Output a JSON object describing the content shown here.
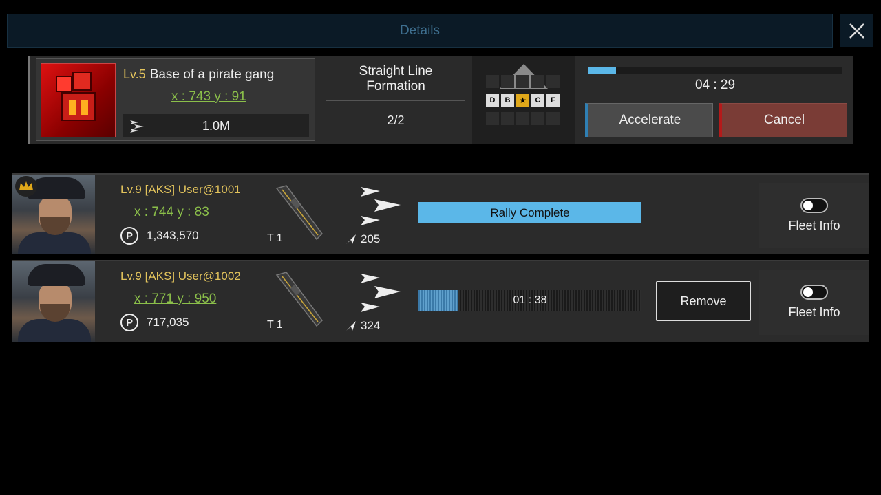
{
  "header": {
    "title": "Details"
  },
  "target": {
    "level": "Lv.5",
    "name": "Base of a pirate gang",
    "coord": "x : 743  y : 91",
    "power": "1.0M",
    "formation_name_line1": "Straight Line",
    "formation_name_line2": "Formation",
    "formation_count": "2/2",
    "grid_labels": [
      "D",
      "B",
      "★",
      "C",
      "F"
    ],
    "progress": 0.11,
    "timer": "04 : 29",
    "accelerate_label": "Accelerate",
    "cancel_label": "Cancel"
  },
  "members": [
    {
      "leader": true,
      "name": "Lv.9 [AKS] User@1001",
      "coord": "x : 744  y : 83",
      "power": "1,343,570",
      "tier": "T 1",
      "troops": "205",
      "status": "Rally Complete",
      "fleet_info_label": "Fleet Info"
    },
    {
      "leader": false,
      "name": "Lv.9 [AKS] User@1002",
      "coord": "x : 771  y : 950",
      "power": "717,035",
      "tier": "T 1",
      "troops": "324",
      "march_timer": "01 : 38",
      "march_progress": 0.18,
      "remove_label": "Remove",
      "fleet_info_label": "Fleet Info"
    }
  ],
  "colors": {
    "accent_blue": "#5bb7e8",
    "coord_green": "#8bbf4a",
    "level_gold": "#e2c35c",
    "cancel_red": "#7a3c36"
  },
  "icons": [
    "close-icon",
    "ship-arrows-icon",
    "crown-icon",
    "power-icon",
    "troop-arrow-icon",
    "toggle-switch"
  ]
}
